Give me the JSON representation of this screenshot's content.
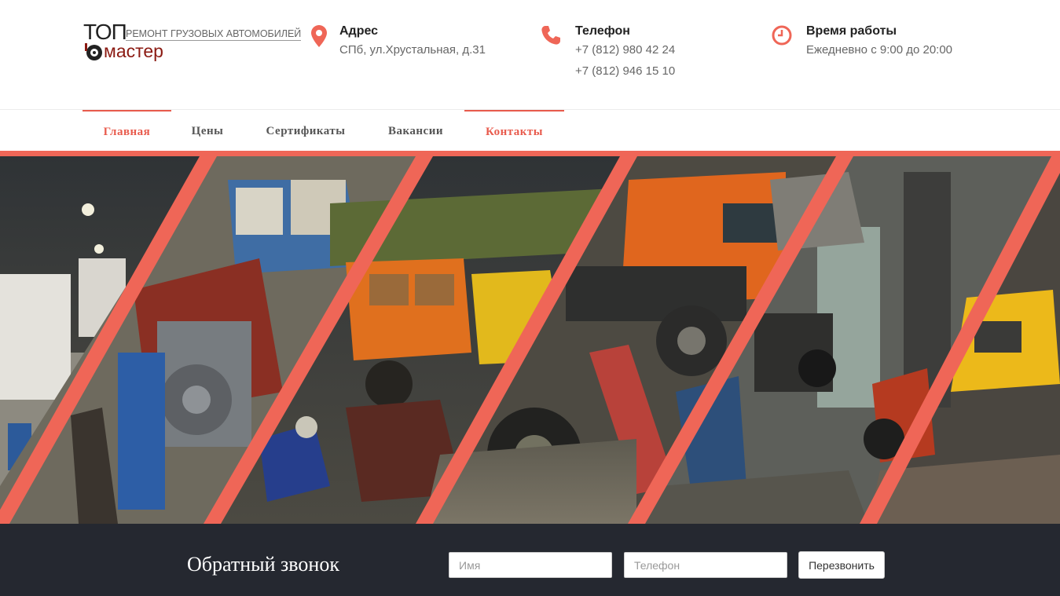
{
  "logo": {
    "top_text": "ТОП",
    "bottom_text": "мастер",
    "tagline": "РЕМОНТ ГРУЗОВЫХ АВТОМОБИЛЕЙ"
  },
  "contacts": {
    "address": {
      "title": "Адрес",
      "icon": "map-pin-icon",
      "lines": [
        "СПб, ул.Хрустальная, д.31"
      ]
    },
    "phone": {
      "title": "Телефон",
      "icon": "phone-icon",
      "lines": [
        "+7 (812) 980 42 24",
        "+7 (812) 946 15 10"
      ]
    },
    "hours": {
      "title": "Время работы",
      "icon": "clock-icon",
      "lines": [
        "Ежедневно с 9:00 до 20:00"
      ]
    }
  },
  "nav": {
    "items": [
      {
        "label": "Главная",
        "active": true
      },
      {
        "label": "Цены",
        "active": false
      },
      {
        "label": "Сертификаты",
        "active": false
      },
      {
        "label": "Вакансии",
        "active": false
      },
      {
        "label": "Контакты",
        "active": true
      }
    ]
  },
  "banner": {
    "description_icon": "truck-workshop-collage"
  },
  "callback": {
    "title": "Обратный звонок",
    "name_placeholder": "Имя",
    "phone_placeholder": "Телефон",
    "name_value": "",
    "phone_value": "",
    "button_label": "Перезвонить"
  },
  "colors": {
    "accent": "#ef6657",
    "nav_active": "#e85b4d",
    "footer_bg": "#252830",
    "logo_red": "#8b1a12"
  }
}
